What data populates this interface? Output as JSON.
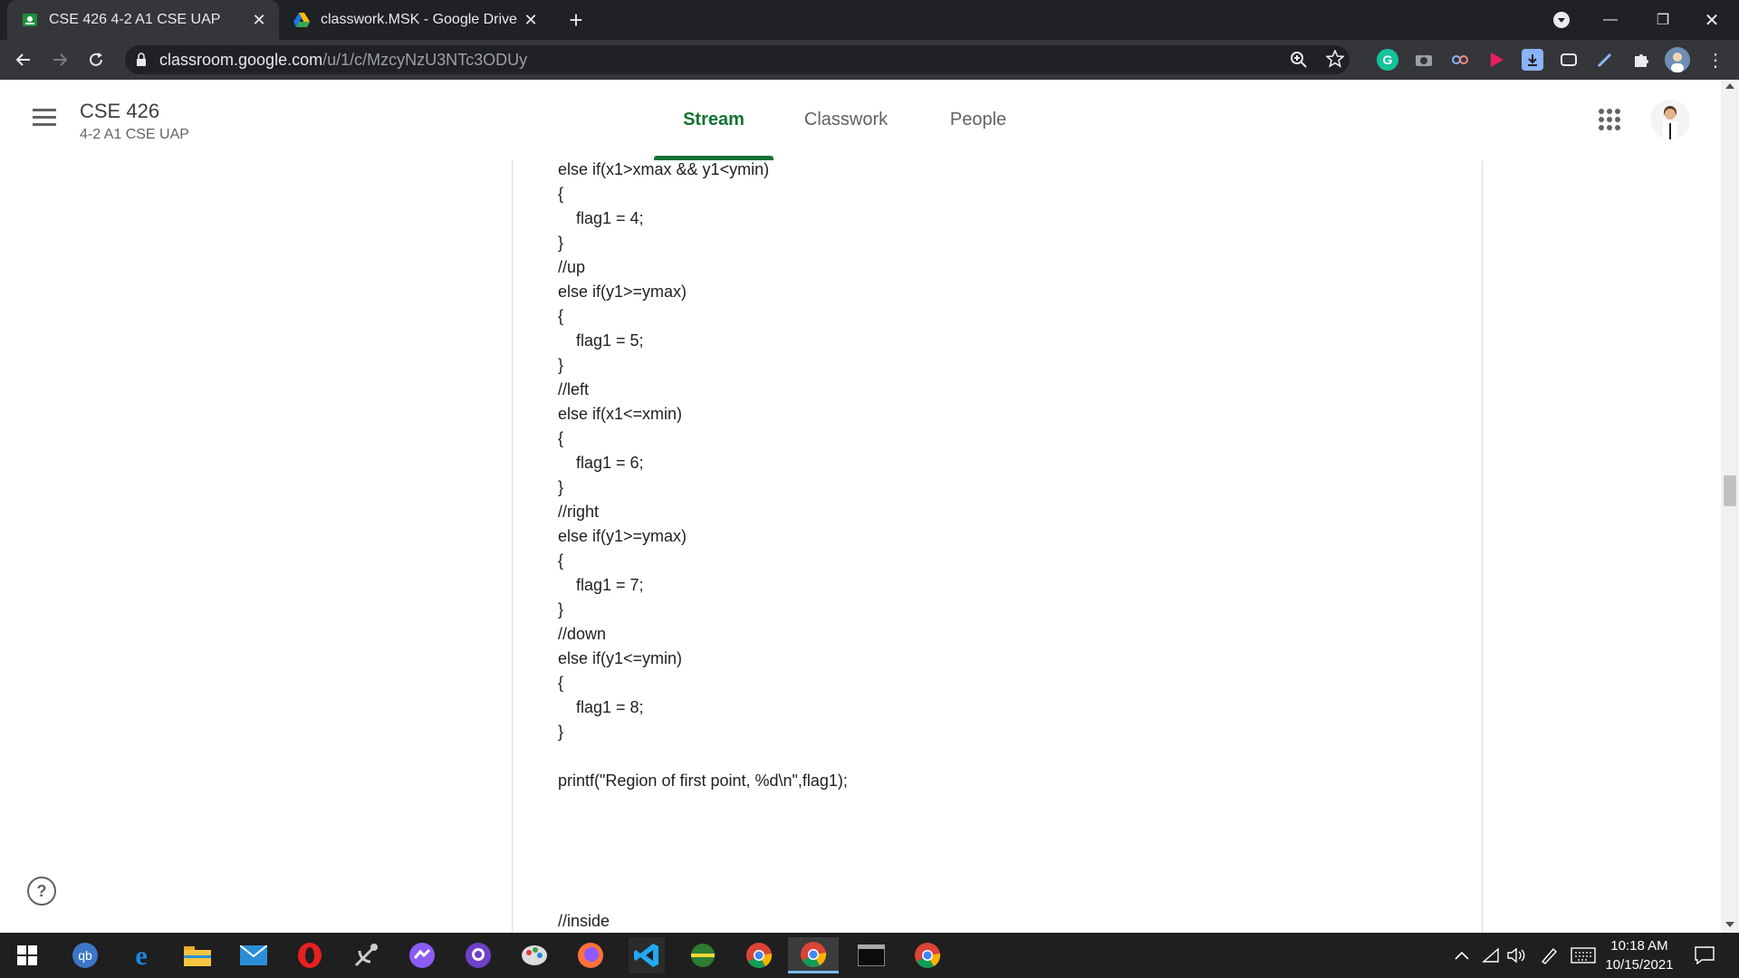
{
  "browser": {
    "tabs": [
      {
        "title": "CSE 426 4-2 A1 CSE UAP",
        "active": true
      },
      {
        "title": "classwork.MSK - Google Drive",
        "active": false
      }
    ],
    "url": {
      "host": "classroom.google.com",
      "path": "/u/1/c/MzcyNzU3NTc3ODUy"
    }
  },
  "header": {
    "class_title": "CSE 426",
    "class_section": "4-2 A1 CSE UAP",
    "tabs": [
      {
        "label": "Stream",
        "active": true
      },
      {
        "label": "Classwork",
        "active": false
      },
      {
        "label": "People",
        "active": false
      }
    ]
  },
  "code_lines": [
    "else if(x1>xmax && y1<ymin)",
    "{",
    "    flag1 = 4;",
    "}",
    "//up",
    "else if(y1>=ymax)",
    "{",
    "    flag1 = 5;",
    "}",
    "//left",
    "else if(x1<=xmin)",
    "{",
    "    flag1 = 6;",
    "}",
    "//right",
    "else if(y1>=ymax)",
    "{",
    "    flag1 = 7;",
    "}",
    "//down",
    "else if(y1<=ymin)",
    "{",
    "    flag1 = 8;",
    "}",
    "printf(\"Region of first point, %d\\n\",flag1);",
    "//inside"
  ],
  "help_label": "?",
  "taskbar": {
    "time": "10:18 AM",
    "date": "10/15/2021"
  },
  "colors": {
    "accent": "#137333",
    "tabstrip": "#202124",
    "toolbar": "#35363a"
  }
}
